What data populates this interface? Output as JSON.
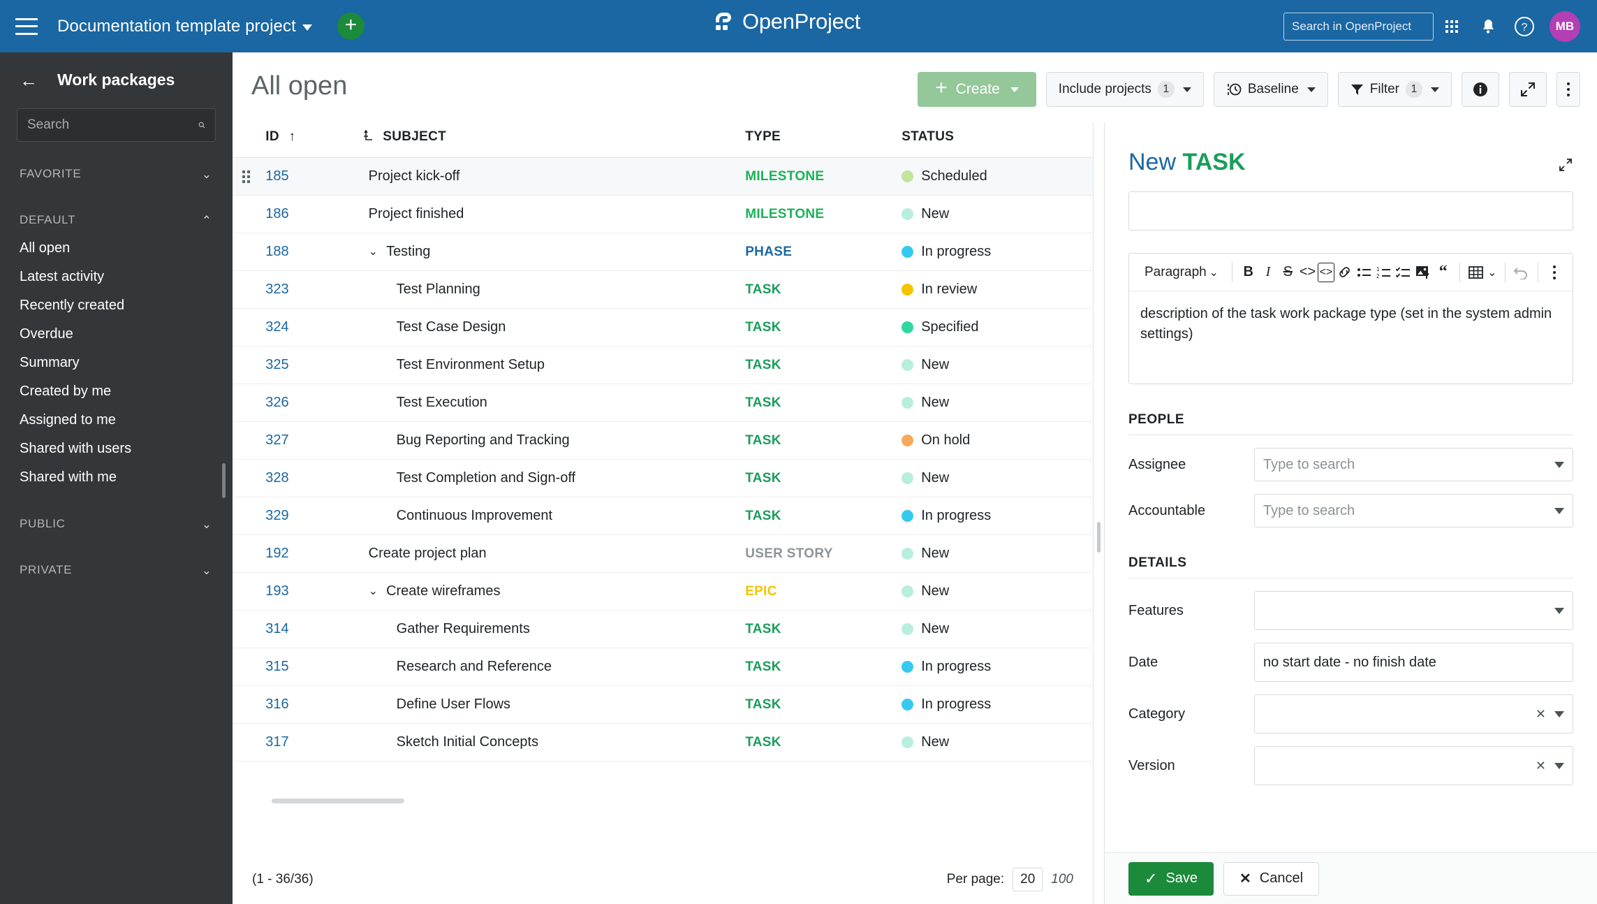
{
  "header": {
    "menu_icon": "hamburger-icon",
    "project_name": "Documentation template project",
    "add_label": "+",
    "logo_text": "OpenProject",
    "search_placeholder": "Search in OpenProject",
    "search_value": "",
    "modules_icon": "grid-icon",
    "notifications_icon": "bell-icon",
    "help_icon": "question-icon",
    "avatar_initials": "MB"
  },
  "sidebar": {
    "back_icon": "arrow-left-icon",
    "title": "Work packages",
    "search_placeholder": "Search",
    "search_value": "",
    "groups": [
      {
        "label": "FAVORITE",
        "expanded": false,
        "chevron": "⌄",
        "items": []
      },
      {
        "label": "DEFAULT",
        "expanded": true,
        "chevron": "⌃",
        "items": [
          "All open",
          "Latest activity",
          "Recently created",
          "Overdue",
          "Summary",
          "Created by me",
          "Assigned to me",
          "Shared with users",
          "Shared with me"
        ]
      },
      {
        "label": "PUBLIC",
        "expanded": false,
        "chevron": "⌄",
        "items": []
      },
      {
        "label": "PRIVATE",
        "expanded": false,
        "chevron": "⌄",
        "items": []
      }
    ]
  },
  "main": {
    "page_title": "All open",
    "toolbar": {
      "create_label": "Create",
      "include_projects_label": "Include projects",
      "include_projects_count": "1",
      "baseline_label": "Baseline",
      "filter_label": "Filter",
      "filter_count": "1",
      "info_icon": "info-icon",
      "fullscreen_icon": "fullscreen-icon",
      "more_icon": "more-vertical-icon"
    },
    "table": {
      "columns": [
        "ID",
        "SUBJECT",
        "TYPE",
        "STATUS"
      ],
      "sort_indicator": "↑",
      "hierarchy_icon": "hierarchy-icon",
      "rows": [
        {
          "id": "185",
          "subject": "Project kick-off",
          "indent": 0,
          "collapse": "",
          "type": "MILESTONE",
          "type_color": "#19B359",
          "status": "Scheduled",
          "status_color": "#C2E59C",
          "highlight": true,
          "handle": true
        },
        {
          "id": "186",
          "subject": "Project finished",
          "indent": 0,
          "collapse": "",
          "type": "MILESTONE",
          "type_color": "#19B359",
          "status": "New",
          "status_color": "#B8EEDE",
          "highlight": false,
          "handle": false
        },
        {
          "id": "188",
          "subject": "Testing",
          "indent": 0,
          "collapse": "⌄",
          "type": "PHASE",
          "type_color": "#1A67A3",
          "status": "In progress",
          "status_color": "#35C9F0",
          "highlight": false,
          "handle": false
        },
        {
          "id": "323",
          "subject": "Test Planning",
          "indent": 1,
          "collapse": "",
          "type": "TASK",
          "type_color": "#1A9D5B",
          "status": "In review",
          "status_color": "#F5C400",
          "highlight": false,
          "handle": false
        },
        {
          "id": "324",
          "subject": "Test Case Design",
          "indent": 1,
          "collapse": "",
          "type": "TASK",
          "type_color": "#1A9D5B",
          "status": "Specified",
          "status_color": "#2ED6A0",
          "highlight": false,
          "handle": false
        },
        {
          "id": "325",
          "subject": "Test Environment Setup",
          "indent": 1,
          "collapse": "",
          "type": "TASK",
          "type_color": "#1A9D5B",
          "status": "New",
          "status_color": "#B8EEDE",
          "highlight": false,
          "handle": false
        },
        {
          "id": "326",
          "subject": "Test Execution",
          "indent": 1,
          "collapse": "",
          "type": "TASK",
          "type_color": "#1A9D5B",
          "status": "New",
          "status_color": "#B8EEDE",
          "highlight": false,
          "handle": false
        },
        {
          "id": "327",
          "subject": "Bug Reporting and Tracking",
          "indent": 1,
          "collapse": "",
          "type": "TASK",
          "type_color": "#1A9D5B",
          "status": "On hold",
          "status_color": "#F7A95C",
          "highlight": false,
          "handle": false
        },
        {
          "id": "328",
          "subject": "Test Completion and Sign-off",
          "indent": 1,
          "collapse": "",
          "type": "TASK",
          "type_color": "#1A9D5B",
          "status": "New",
          "status_color": "#B8EEDE",
          "highlight": false,
          "handle": false
        },
        {
          "id": "329",
          "subject": "Continuous Improvement",
          "indent": 1,
          "collapse": "",
          "type": "TASK",
          "type_color": "#1A9D5B",
          "status": "In progress",
          "status_color": "#35C9F0",
          "highlight": false,
          "handle": false
        },
        {
          "id": "192",
          "subject": "Create project plan",
          "indent": 0,
          "collapse": "",
          "type": "USER STORY",
          "type_color": "#8E9497",
          "status": "New",
          "status_color": "#B8EEDE",
          "highlight": false,
          "handle": false
        },
        {
          "id": "193",
          "subject": "Create wireframes",
          "indent": 0,
          "collapse": "⌄",
          "type": "EPIC",
          "type_color": "#F5C400",
          "status": "New",
          "status_color": "#B8EEDE",
          "highlight": false,
          "handle": false
        },
        {
          "id": "314",
          "subject": "Gather Requirements",
          "indent": 1,
          "collapse": "",
          "type": "TASK",
          "type_color": "#1A9D5B",
          "status": "New",
          "status_color": "#B8EEDE",
          "highlight": false,
          "handle": false
        },
        {
          "id": "315",
          "subject": "Research and Reference",
          "indent": 1,
          "collapse": "",
          "type": "TASK",
          "type_color": "#1A9D5B",
          "status": "In progress",
          "status_color": "#35C9F0",
          "highlight": false,
          "handle": false
        },
        {
          "id": "316",
          "subject": "Define User Flows",
          "indent": 1,
          "collapse": "",
          "type": "TASK",
          "type_color": "#1A9D5B",
          "status": "In progress",
          "status_color": "#35C9F0",
          "highlight": false,
          "handle": false
        },
        {
          "id": "317",
          "subject": "Sketch Initial Concepts",
          "indent": 1,
          "collapse": "",
          "type": "TASK",
          "type_color": "#1A9D5B",
          "status": "New",
          "status_color": "#B8EEDE",
          "highlight": false,
          "handle": false
        }
      ]
    },
    "pagination": {
      "range": "(1 - 36/36)",
      "per_page_label": "Per page:",
      "per_page_current": "20",
      "per_page_other": "100"
    }
  },
  "detail": {
    "title_new": "New",
    "title_type": "TASK",
    "expand_icon": "expand-diagonal-icon",
    "subject_value": "",
    "subject_placeholder": "",
    "editor": {
      "paragraph_label": "Paragraph",
      "buttons": [
        "bold-icon",
        "italic-icon",
        "strikethrough-icon",
        "inline-code-icon",
        "code-block-icon",
        "link-icon",
        "bullet-list-icon",
        "numbered-list-icon",
        "checklist-icon",
        "image-upload-icon",
        "blockquote-icon",
        "table-icon",
        "undo-icon",
        "editor-more-icon"
      ],
      "content": "description of the task work package type (set in the system admin settings)"
    },
    "people_section": "PEOPLE",
    "assignee_label": "Assignee",
    "assignee_placeholder": "Type to search",
    "assignee_value": "",
    "accountable_label": "Accountable",
    "accountable_placeholder": "Type to search",
    "accountable_value": "",
    "details_section": "DETAILS",
    "features_label": "Features",
    "features_value": "",
    "date_label": "Date",
    "date_value": "no start date - no finish date",
    "category_label": "Category",
    "category_value": "",
    "version_label": "Version",
    "version_value": "",
    "save_label": "Save",
    "cancel_label": "Cancel",
    "save_icon": "check-icon",
    "cancel_icon": "x-icon"
  }
}
